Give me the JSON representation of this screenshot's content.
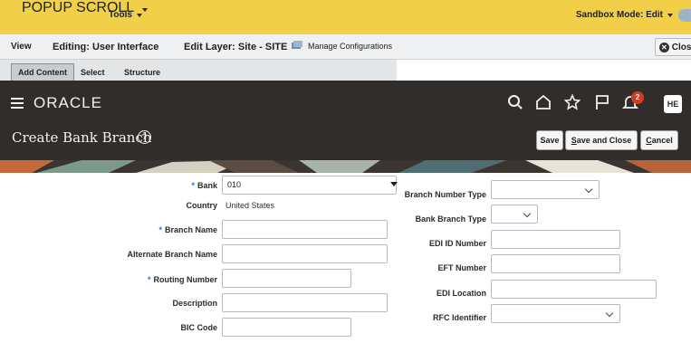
{
  "sandbox": {
    "popup_scroll": "POPUP SCROLL",
    "tools": "Tools",
    "mode": "Sandbox Mode: Edit"
  },
  "editbar": {
    "view": "View",
    "editing": "Editing: User Interface",
    "edit_layer": "Edit Layer: Site - SITE",
    "manage_configurations": "Manage Configurations",
    "close": "Close"
  },
  "tabs": [
    "Add Content",
    "Select",
    "Structure"
  ],
  "header": {
    "logo": "ORACLE",
    "notification_count": "2",
    "avatar_initials": "HE"
  },
  "page": {
    "title": "Create Bank Branch",
    "help": "?",
    "buttons": {
      "save": "Save",
      "save_and_close_prefix": "S",
      "save_and_close_rest": "ave and Close",
      "cancel_prefix": "C",
      "cancel_rest": "ancel"
    }
  },
  "form_left": {
    "bank_label": "Bank",
    "bank_value": "010",
    "country_label": "Country",
    "country_value": "United States",
    "branch_name_label": "Branch Name",
    "alternate_branch_name_label": "Alternate Branch Name",
    "routing_number_label": "Routing Number",
    "description_label": "Description",
    "bic_code_label": "BIC Code",
    "required_marker": "*"
  },
  "form_right": {
    "branch_number_type_label": "Branch Number Type",
    "bank_branch_type_label": "Bank Branch Type",
    "edi_id_number_label": "EDI ID Number",
    "eft_number_label": "EFT Number",
    "edi_location_label": "EDI Location",
    "rfc_identifier_label": "RFC Identifier"
  }
}
